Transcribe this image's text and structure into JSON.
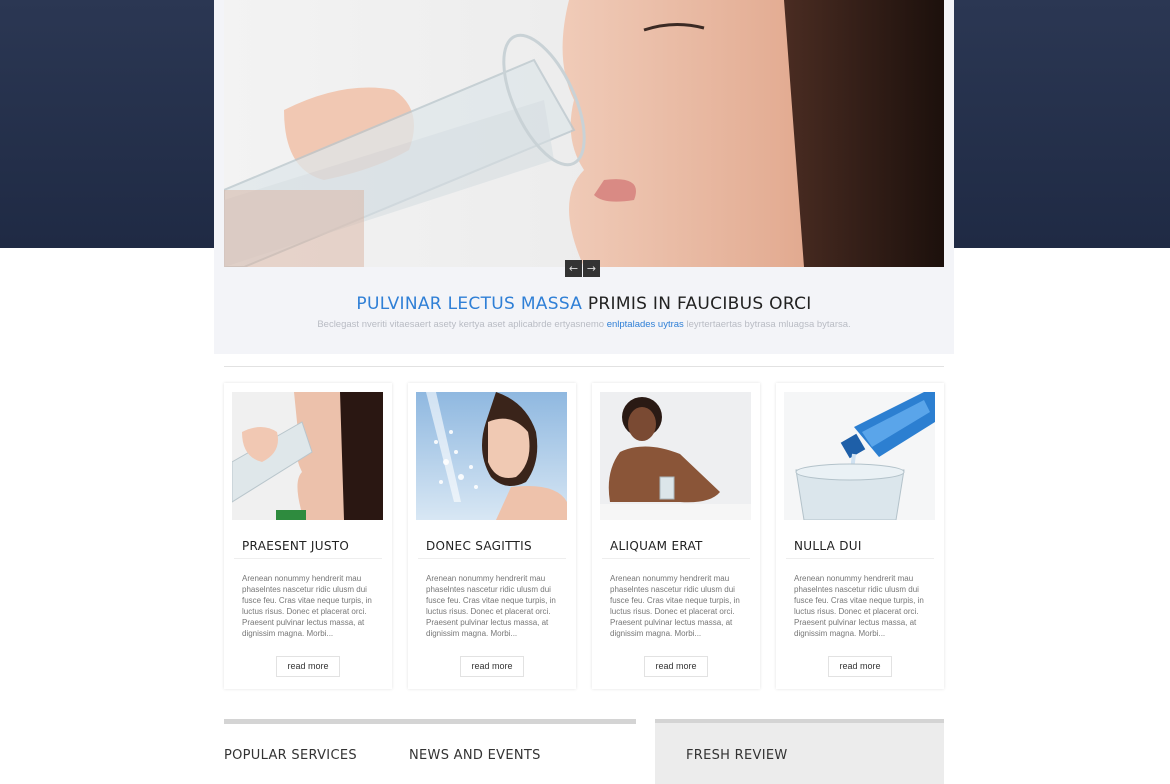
{
  "slider": {
    "prev_icon": "←",
    "next_icon": "→"
  },
  "tagline": {
    "highlight": "PULVINAR LECTUS MASSA",
    "rest": "PRIMIS IN FAUCIBUS ORCI"
  },
  "subline": {
    "before": "Beclegast nveriti vitaesaert asety kertya aset aplicabrde ertyasnemo",
    "link": "enlptalades uytras",
    "after": "leyrtertaertas bytrasa mluagsa bytarsa."
  },
  "cards": [
    {
      "title": "PRAESENT JUSTO",
      "text": "Arenean nonummy hendrerit mau phaselntes nascetur ridic ulusm dui fusce feu. Cras vitae neque turpis, in luctus risus. Donec et placerat orci. Praesent pulvinar lectus massa, at dignissim magna. Morbi...",
      "button": "read more"
    },
    {
      "title": "DONEC SAGITTIS",
      "text": "Arenean nonummy hendrerit mau phaselntes nascetur ridic ulusm dui fusce feu. Cras vitae neque turpis, in luctus risus. Donec et placerat orci. Praesent pulvinar lectus massa, at dignissim magna. Morbi...",
      "button": "read more"
    },
    {
      "title": "ALIQUAM ERAT",
      "text": "Arenean nonummy hendrerit mau phaselntes nascetur ridic ulusm dui fusce feu. Cras vitae neque turpis, in luctus risus. Donec et placerat orci. Praesent pulvinar lectus massa, at dignissim magna. Morbi...",
      "button": "read more"
    },
    {
      "title": "NULLA DUI",
      "text": "Arenean nonummy hendrerit mau phaselntes nascetur ridic ulusm dui fusce feu. Cras vitae neque turpis, in luctus risus. Donec et placerat orci. Praesent pulvinar lectus massa, at dignissim magna. Morbi...",
      "button": "read more"
    }
  ],
  "footer": {
    "popular": "POPULAR SERVICES",
    "news": "NEWS AND EVENTS",
    "review": "FRESH REVIEW"
  }
}
